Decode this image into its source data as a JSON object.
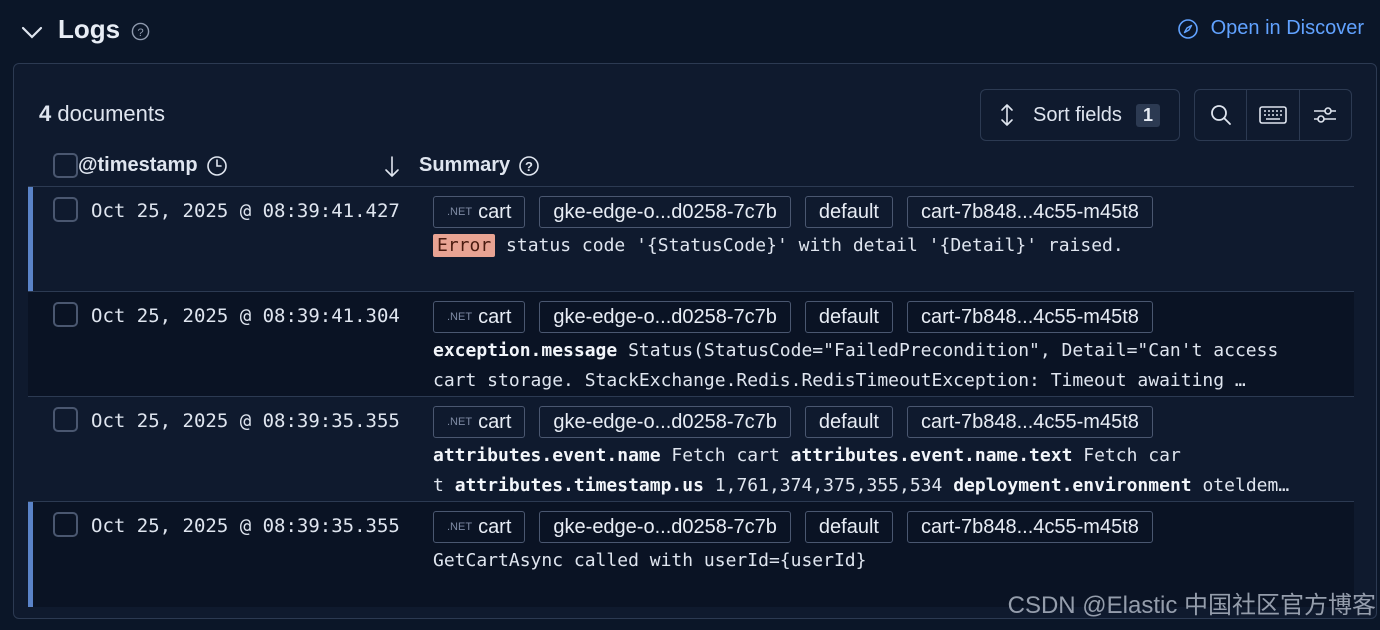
{
  "header": {
    "title": "Logs",
    "open_in_discover": "Open in Discover"
  },
  "toolbar": {
    "documents_count": "4",
    "documents_label": "documents",
    "sort_fields_label": "Sort fields",
    "sort_fields_count": "1"
  },
  "columns": {
    "timestamp": "@timestamp",
    "summary": "Summary"
  },
  "rows": [
    {
      "timestamp": "Oct 25, 2025 @ 08:39:41.427",
      "badges": {
        "service_prefix": ".NET",
        "service": "cart",
        "host": "gke-edge-o...d0258-7c7b",
        "namespace": "default",
        "pod": "cart-7b848...4c55-m45t8"
      },
      "level": "Error",
      "message": "status code '{StatusCode}' with detail '{Detail}' raised."
    },
    {
      "timestamp": "Oct 25, 2025 @ 08:39:41.304",
      "badges": {
        "service_prefix": ".NET",
        "service": "cart",
        "host": "gke-edge-o...d0258-7c7b",
        "namespace": "default",
        "pod": "cart-7b848...4c55-m45t8"
      },
      "field1_key": "exception.message",
      "field1_value": "Status(StatusCode=\"FailedPrecondition\", Detail=\"Can't access",
      "line2": "cart storage. StackExchange.Redis.RedisTimeoutException: Timeout awaiting …"
    },
    {
      "timestamp": "Oct 25, 2025 @ 08:39:35.355",
      "badges": {
        "service_prefix": ".NET",
        "service": "cart",
        "host": "gke-edge-o...d0258-7c7b",
        "namespace": "default",
        "pod": "cart-7b848...4c55-m45t8"
      },
      "k1": "attributes.event.name",
      "v1": "Fetch cart",
      "k2": "attributes.event.name.text",
      "v2": "Fetch car",
      "v2b": "t",
      "k3": "attributes.timestamp.us",
      "v3": "1,761,374,375,355,534",
      "k4": "deployment.environment",
      "v4": "oteldem…"
    },
    {
      "timestamp": "Oct 25, 2025 @ 08:39:35.355",
      "badges": {
        "service_prefix": ".NET",
        "service": "cart",
        "host": "gke-edge-o...d0258-7c7b",
        "namespace": "default",
        "pod": "cart-7b848...4c55-m45t8"
      },
      "message": "GetCartAsync called with userId={userId}"
    }
  ],
  "watermark": "CSDN @Elastic 中国社区官方博客",
  "colors": {
    "background": "#0b1628",
    "accent_link": "#61a2ff",
    "error_badge": "#e8a393",
    "row_accent": "#5a83c8"
  }
}
